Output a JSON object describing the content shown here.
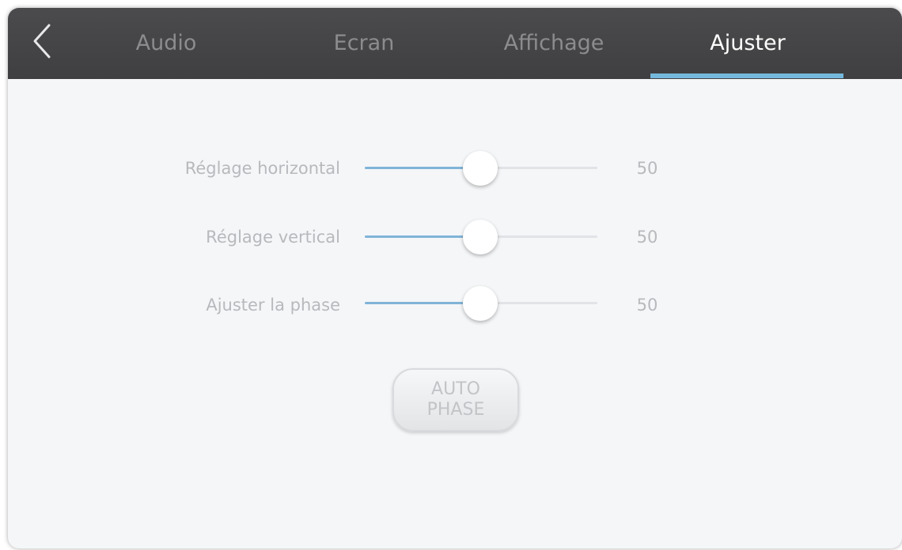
{
  "tabs": [
    {
      "label": "Audio",
      "active": false
    },
    {
      "label": "Ecran",
      "active": false
    },
    {
      "label": "Affichage",
      "active": false
    },
    {
      "label": "Ajuster",
      "active": true
    }
  ],
  "back_icon": "chevron-left-icon",
  "sliders": [
    {
      "label": "Réglage horizontal",
      "value": "50",
      "level": 0.5
    },
    {
      "label": "Réglage vertical",
      "value": "50",
      "level": 0.5
    },
    {
      "label": "Ajuster la phase",
      "value": "50",
      "level": 0.5
    }
  ],
  "auto_phase": {
    "line1": "AUTO",
    "line2": "PHASE"
  },
  "colors": {
    "header_bg": "#434345",
    "tab_inactive": "#8c8c8e",
    "tab_active": "#ffffff",
    "accent": "#74b8dc",
    "content_bg": "#f4f6f8"
  }
}
